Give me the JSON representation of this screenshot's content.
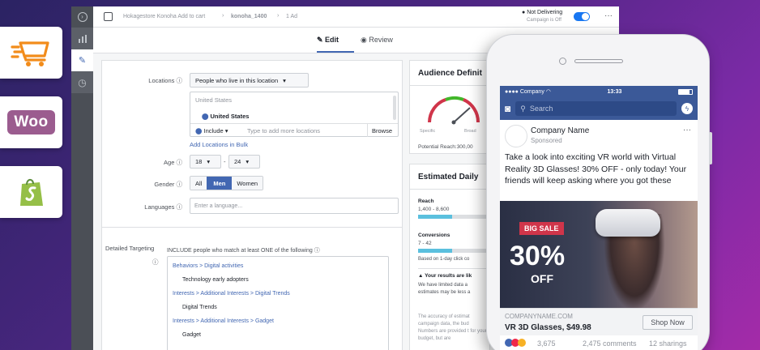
{
  "tiles": {
    "woo_label": "Woo"
  },
  "window": {
    "breadcrumb": [
      "Hokagestore Konoha Add to cart",
      "konoha_1400",
      "1 Ad"
    ],
    "delivery_status": "Not Delivering",
    "delivery_sub": "Campaign is Off",
    "more": "···",
    "tabs": {
      "edit": "Edit",
      "review": "Review"
    }
  },
  "form": {
    "locations_label": "Locations",
    "locations_select": "People who live in this location",
    "country_header": "United States",
    "country_item": "United States",
    "include": "Include",
    "location_placeholder": "Type to add more locations",
    "browse": "Browse",
    "bulk_link": "Add Locations in Bulk",
    "age_label": "Age",
    "age_min": "18",
    "age_sep": "-",
    "age_max": "24",
    "gender_label": "Gender",
    "gender_options": [
      "All",
      "Men",
      "Women"
    ],
    "gender_selected": "Men",
    "languages_label": "Languages",
    "language_placeholder": "Enter a language...",
    "detailed_label": "Detailed Targeting",
    "detailed_desc": "INCLUDE people who match at least ONE of the following",
    "targeting": [
      {
        "path": "Behaviors > Digital activities",
        "item": "Technology early adopters"
      },
      {
        "path": "Interests > Additional Interests > Digital Trends",
        "item": "Digital Trends"
      },
      {
        "path": "Interests > Additional Interests > Gadget",
        "item": "Gadget"
      }
    ]
  },
  "audience": {
    "title": "Audience Definit",
    "specific": "Specific",
    "broad": "Broad",
    "potential": "Potential Reach:300,00"
  },
  "estimated": {
    "title": "Estimated Daily",
    "reach_label": "Reach",
    "reach_value": "1,400 - 8,600",
    "conv_label": "Conversions",
    "conv_value": "7 - 42",
    "basis": "Based on 1-day click co",
    "warn_title": "Your results are lik",
    "warn_text": "We have limited data a estimates may be less a",
    "accuracy_text": "The accuracy of estimat campaign data, the bud Numbers are provided t for your budget, but are"
  },
  "phone": {
    "carrier": "Company",
    "time": "13:33",
    "search": "Search",
    "page_name": "Company Name",
    "sponsored": "Sponsored",
    "post_text": "Take a look into exciting VR  world with Virtual Reality 3D Glasses! 30% OFF - only today! Your friends will keep asking where you got these",
    "sale_tag": "BIG SALE",
    "sale_pct": "30%",
    "sale_off": "OFF",
    "domain": "COMPANYNAME.COM",
    "product": "VR 3D Glasses, $49.98",
    "cta": "Shop Now",
    "reactions": "3,675",
    "comments": "2,475 comments",
    "shares": "12 sharings"
  },
  "colors": {
    "fb_blue": "#3b5998",
    "link_blue": "#4267b2",
    "toggle": "#1877f2",
    "sale_red": "#d0354a"
  }
}
